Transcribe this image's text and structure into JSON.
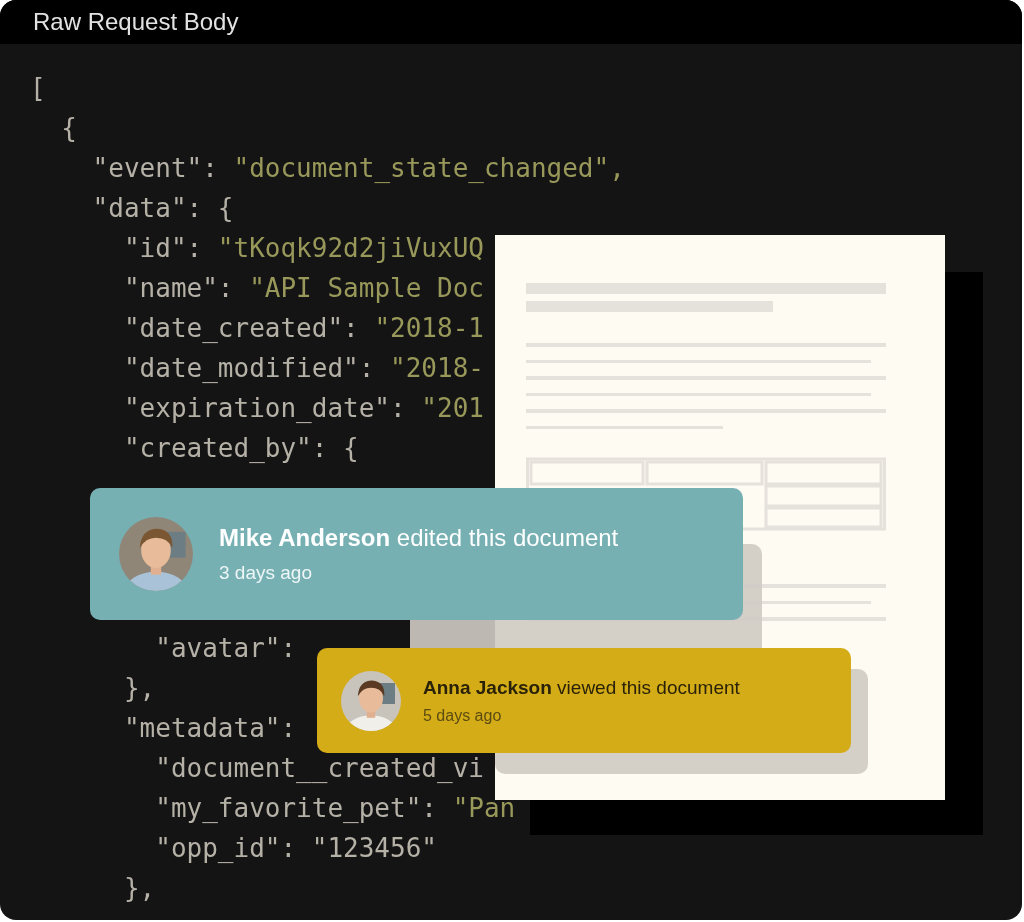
{
  "window": {
    "title": "Raw Request Body"
  },
  "code": {
    "upper": [
      {
        "text": "["
      },
      {
        "text": "  {"
      },
      {
        "text": "    \"event\": ",
        "string": "\"document_state_changed\","
      },
      {
        "text": "    \"data\": {"
      },
      {
        "text": "      \"id\": ",
        "string": "\"tKoqk92d2jiVuxUQ"
      },
      {
        "text": "      \"name\": ",
        "string": "\"API Sample Doc"
      },
      {
        "text": "      \"date_created\": ",
        "string": "\"2018-1"
      },
      {
        "text": "      \"date_modified\": ",
        "string": "\"2018-"
      },
      {
        "text": "      \"expiration_date\": ",
        "string": "\"201"
      },
      {
        "text": "      \"created_by\": {"
      }
    ],
    "lower": [
      {
        "text": "        \"avatar\":"
      },
      {
        "text": "      },"
      },
      {
        "text": "      \"metadata\":"
      },
      {
        "text": "        \"document__created_vi"
      },
      {
        "text": "        \"my_favorite_pet\": ",
        "string": "\"Pan"
      },
      {
        "text": "        \"opp_id\": \"123456\""
      },
      {
        "text": "      },"
      }
    ]
  },
  "activity": [
    {
      "kind": "edited",
      "message": "**Mike Anderson** edited this document",
      "time": "3 days ago",
      "color": "#76b0b3"
    },
    {
      "kind": "viewed",
      "message": "**Anna Jackson** viewed this document",
      "time": "5 days ago",
      "color": "#d4ac17"
    }
  ]
}
